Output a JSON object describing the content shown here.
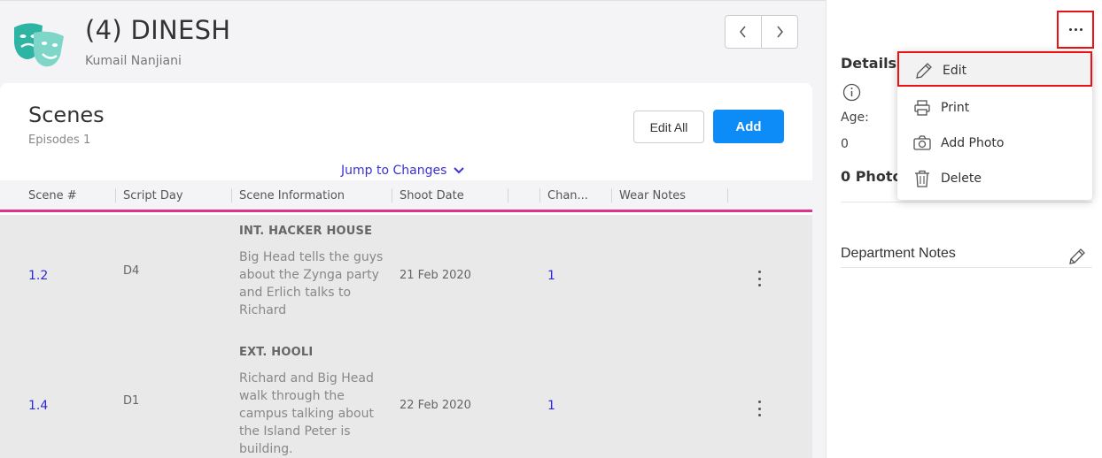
{
  "header": {
    "title": "(4) DINESH",
    "subtitle": "Kumail Nanjiani"
  },
  "scenes": {
    "title": "Scenes",
    "subtitle": "Episodes 1",
    "edit_all_label": "Edit All",
    "add_label": "Add",
    "jump_label": "Jump to Changes",
    "columns": [
      "Scene #",
      "Script Day",
      "Scene Information",
      "Shoot Date",
      "Chan...",
      "Wear Notes"
    ],
    "rows": [
      {
        "scene": "1.2",
        "day": "D4",
        "heading": "INT. HACKER HOUSE",
        "body": "Big Head tells the guys about the Zynga party and Erlich talks to Richard",
        "date": "21 Feb 2020",
        "changes": "1"
      },
      {
        "scene": "1.4",
        "day": "D1",
        "heading": "EXT. HOOLI",
        "body": "Richard and Big Head walk through the campus talking about the Island Peter is building.",
        "date": "22 Feb 2020",
        "changes": "1"
      }
    ]
  },
  "details": {
    "title": "Details",
    "age_label": "Age:",
    "age_value": "0",
    "photos_label": "0 Photos",
    "department_notes_label": "Department Notes"
  },
  "menu": {
    "items": [
      {
        "label": "Edit",
        "icon": "pencil-icon"
      },
      {
        "label": "Print",
        "icon": "printer-icon"
      },
      {
        "label": "Add Photo",
        "icon": "camera-icon"
      },
      {
        "label": "Delete",
        "icon": "trash-icon"
      }
    ]
  },
  "colors": {
    "accent_blue": "#0d8cf7",
    "link_blue": "#2d28d6",
    "divider_pink": "#e0348a",
    "highlight_red": "#ee1111"
  }
}
